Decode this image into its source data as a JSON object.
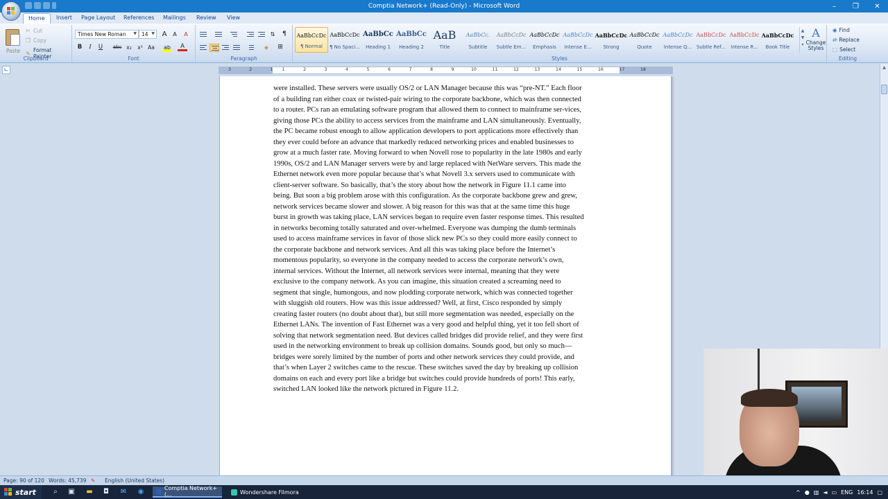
{
  "window": {
    "title": "Comptia Network+ (Read-Only) - Microsoft Word",
    "controls": [
      "–",
      "❐",
      "✕"
    ]
  },
  "ribbon_tabs": [
    {
      "label": "Home",
      "active": true
    },
    {
      "label": "Insert"
    },
    {
      "label": "Page Layout"
    },
    {
      "label": "References"
    },
    {
      "label": "Mailings"
    },
    {
      "label": "Review"
    },
    {
      "label": "View"
    }
  ],
  "clipboard": {
    "paste": "Paste",
    "cut": "Cut",
    "copy": "Copy",
    "format_painter": "Format Painter",
    "label": "Clipboard"
  },
  "font": {
    "name": "Times New Roman",
    "size": "14",
    "label": "Font",
    "bold": "B",
    "italic": "I",
    "underline": "U",
    "strike": "abc",
    "subscript": "x₂",
    "superscript": "x²",
    "change_case": "Aa",
    "grow": "A",
    "shrink": "A",
    "clear": "A"
  },
  "paragraph": {
    "label": "Paragraph"
  },
  "styles": {
    "label": "Styles",
    "items": [
      {
        "preview": "AaBbCcDc",
        "name": "¶ Normal",
        "selected": true,
        "color": "#111111"
      },
      {
        "preview": "AaBbCcDc",
        "name": "¶ No Spaci...",
        "color": "#111111"
      },
      {
        "preview": "AaBbCc",
        "name": "Heading 1",
        "color": "#17365d"
      },
      {
        "preview": "AaBbCc",
        "name": "Heading 2",
        "color": "#365f91"
      },
      {
        "preview": "AaB",
        "name": "Title",
        "color": "#17365d"
      },
      {
        "preview": "AaBbCc.",
        "name": "Subtitle",
        "color": "#4f81bd"
      },
      {
        "preview": "AaBbCcDc",
        "name": "Subtle Em...",
        "color": "#808080"
      },
      {
        "preview": "AaBbCcDc",
        "name": "Emphasis",
        "color": "#111111"
      },
      {
        "preview": "AaBbCcDc",
        "name": "Intense E...",
        "color": "#4f81bd"
      },
      {
        "preview": "AaBbCcDc",
        "name": "Strong",
        "color": "#111111"
      },
      {
        "preview": "AaBbCcDc",
        "name": "Quote",
        "color": "#111111"
      },
      {
        "preview": "AaBbCcDc",
        "name": "Intense Q...",
        "color": "#4f81bd"
      },
      {
        "preview": "AaBbCcDc",
        "name": "Subtle Ref...",
        "color": "#c0504d"
      },
      {
        "preview": "AaBbCcDc",
        "name": "Intense R...",
        "color": "#c0504d"
      },
      {
        "preview": "AaBbCcDc",
        "name": "Book Title",
        "color": "#111111"
      }
    ],
    "change_styles": "Change Styles"
  },
  "editing": {
    "label": "Editing",
    "find": "Find",
    "replace": "Replace",
    "select": "Select"
  },
  "document": {
    "lines": [
      "were installed. These servers were usually OS/2 or LAN Manager because this was “pre-NT.” Each floor",
      "of a building ran either coax or twisted-pair wiring to the corporate backbone, which was then connected",
      "to a router. PCs ran an emulating software program that allowed them to connect to mainframe ser-vices,",
      "giving those PCs the ability to access services from the mainframe and LAN simultaneously. Eventually,",
      "the PC became robust enough to allow application developers to port applications more effectively than",
      "they ever could before an advance that markedly reduced networking prices and enabled businesses to",
      "grow at a much faster rate. Moving forward to when Novell rose to popularity in the late 1980s and early",
      "1990s, OS/2 and LAN Manager servers were by and large replaced with NetWare servers. This made the",
      "Ethernet network even more popular because that’s what Novell 3.x servers used to communicate with",
      "client-server software. So basically, that’s the story about how the network in Figure 11.1 came into",
      "being. But soon a big problem arose with this configuration. As the corporate backbone grew and grew,",
      "network services became slower and slower. A big reason for this was that at the same time this huge",
      "burst in growth was taking place, LAN services began to require even faster response times. This resulted",
      "in networks becoming totally saturated and over-whelmed. Everyone was dumping the dumb terminals",
      "used to access mainframe services in favor of those slick new PCs so they could more easily connect to",
      "the corporate backbone and network services. And all this was taking place before the Internet’s",
      "momentous popularity, so everyone in the company needed to access the corporate network’s own,",
      "internal services. Without the Internet, all network services were internal, meaning that they were",
      "exclusive to the company network. As you can imagine, this situation created a screaming need to",
      "segment that single, humongous, and now plodding corporate network, which was connected together",
      "with sluggish old routers. How was this issue addressed? Well, at first, Cisco responded by simply",
      "creating faster routers (no doubt about that), but still more segmentation was needed, especially on the",
      "Ethernet LANs. The invention of Fast Ethernet was a very good and helpful thing, yet it too fell short of",
      "solving that network segmentation need. But devices called bridges did provide relief, and they were first",
      "used in the networking environment to break up collision domains. Sounds good, but only so much—",
      "bridges were sorely limited by the number of ports and other network services they could provide, and",
      "that’s when Layer 2 switches came to the rescue. These switches saved the day by breaking up collision",
      "domains on each and every port like a bridge but switches could provide hundreds of ports! This early,",
      "switched LAN looked like the network pictured in Figure 11.2."
    ]
  },
  "ruler": {
    "numbers": [
      "3",
      "2",
      "1",
      "1",
      "2",
      "3",
      "4",
      "5",
      "6",
      "7",
      "8",
      "9",
      "10",
      "11",
      "12",
      "13",
      "14",
      "15",
      "16",
      "17",
      "18"
    ]
  },
  "status": {
    "page": "Page: 90 of 120",
    "words": "Words: 45,739",
    "language": "English (United States)"
  },
  "taskbar": {
    "start": "start",
    "tasks": [
      {
        "label": "Comptia Network+ (...",
        "active": true
      },
      {
        "label": "Wondershare Filmora"
      }
    ],
    "tray_lang": "ENG",
    "clock": "16:14"
  },
  "colors": {
    "titlebar": "#1979ca",
    "ribbon_accent": "#15428b",
    "taskbar": "#17243a"
  }
}
